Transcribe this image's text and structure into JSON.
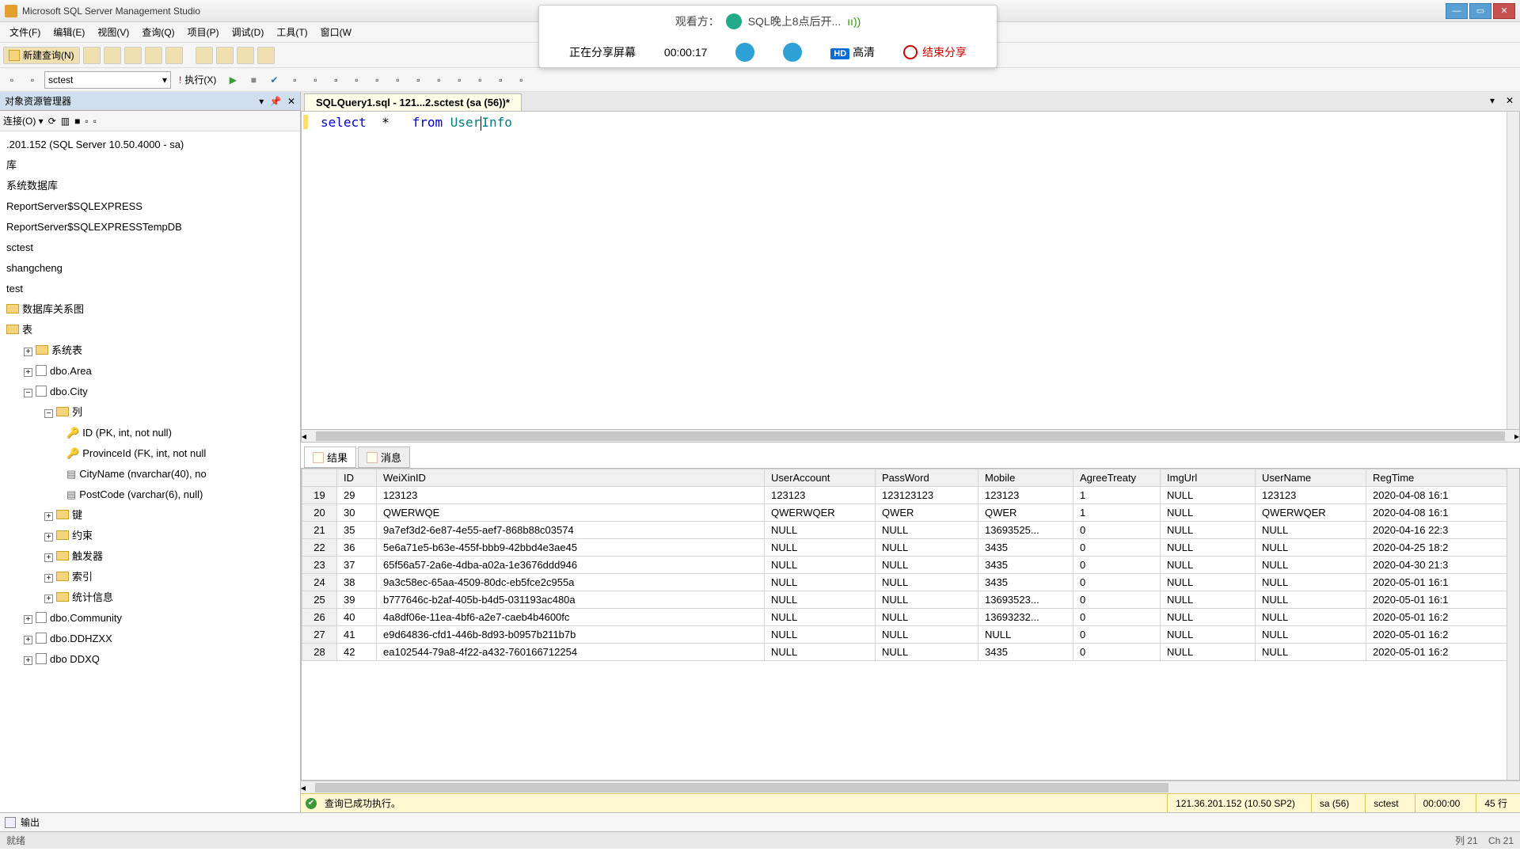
{
  "app": {
    "title": "Microsoft SQL Server Management Studio"
  },
  "menus": [
    "文件(F)",
    "编辑(E)",
    "视图(V)",
    "查询(Q)",
    "项目(P)",
    "调试(D)",
    "工具(T)",
    "窗口(W"
  ],
  "toolbar": {
    "new_query": "新建查询(N)"
  },
  "toolbar2": {
    "db_selected": "sctest",
    "execute": "执行(X)"
  },
  "share": {
    "viewer_label": "观看方：",
    "viewer_name": "SQL晚上8点后开...",
    "sharing_label": "正在分享屏幕",
    "duration": "00:00:17",
    "hd": "HD",
    "quality": "高清",
    "end": "结束分享"
  },
  "explorer": {
    "title": "对象资源管理器",
    "connect": "连接(O)",
    "server": ".201.152 (SQL Server 10.50.4000 - sa)",
    "nodes": {
      "db_root": "库",
      "sysdb": "系统数据库",
      "rptsrv": "ReportServer$SQLEXPRESS",
      "rptsrvtmp": "ReportServer$SQLEXPRESSTempDB",
      "sctest": "sctest",
      "shangcheng": "shangcheng",
      "test": "test",
      "diagram": "数据库关系图",
      "tables": "表",
      "systables": "系统表",
      "area": "dbo.Area",
      "city": "dbo.City",
      "cols": "列",
      "col_id": "ID (PK, int, not null)",
      "col_prov": "ProvinceId (FK, int, not null",
      "col_city": "CityName (nvarchar(40), no",
      "col_post": "PostCode (varchar(6), null)",
      "keys": "键",
      "constraints": "约束",
      "triggers": "触发器",
      "indexes": "索引",
      "stats": "统计信息",
      "community": "dbo.Community",
      "ddhzxx": "dbo.DDHZXX",
      "ddxq": "dbo  DDXQ"
    }
  },
  "tab": {
    "title": "SQLQuery1.sql - 121...2.sctest (sa (56))*"
  },
  "sql": {
    "select": "select",
    "star": "*",
    "from": "from",
    "user": "User",
    "info": "Info"
  },
  "results_tabs": {
    "results": "结果",
    "messages": "消息"
  },
  "grid": {
    "headers": [
      "",
      "ID",
      "WeiXinID",
      "UserAccount",
      "PassWord",
      "Mobile",
      "AgreeTreaty",
      "ImgUrl",
      "UserName",
      "RegTime"
    ],
    "rows": [
      {
        "n": "19",
        "ID": "29",
        "WeiXinID": "123123",
        "UserAccount": "123123",
        "PassWord": "123123123",
        "Mobile": "123123",
        "AgreeTreaty": "1",
        "ImgUrl": "NULL",
        "UserName": "123123",
        "RegTime": "2020-04-08 16:1"
      },
      {
        "n": "20",
        "ID": "30",
        "WeiXinID": "QWERWQE",
        "UserAccount": "QWERWQER",
        "PassWord": "QWER",
        "Mobile": "QWER",
        "AgreeTreaty": "1",
        "ImgUrl": "NULL",
        "UserName": "QWERWQER",
        "RegTime": "2020-04-08 16:1"
      },
      {
        "n": "21",
        "ID": "35",
        "WeiXinID": "9a7ef3d2-6e87-4e55-aef7-868b88c03574",
        "UserAccount": "NULL",
        "PassWord": "NULL",
        "Mobile": "13693525...",
        "AgreeTreaty": "0",
        "ImgUrl": "NULL",
        "UserName": "NULL",
        "RegTime": "2020-04-16 22:3"
      },
      {
        "n": "22",
        "ID": "36",
        "WeiXinID": "5e6a71e5-b63e-455f-bbb9-42bbd4e3ae45",
        "UserAccount": "NULL",
        "PassWord": "NULL",
        "Mobile": "3435",
        "AgreeTreaty": "0",
        "ImgUrl": "NULL",
        "UserName": "NULL",
        "RegTime": "2020-04-25 18:2"
      },
      {
        "n": "23",
        "ID": "37",
        "WeiXinID": "65f56a57-2a6e-4dba-a02a-1e3676ddd946",
        "UserAccount": "NULL",
        "PassWord": "NULL",
        "Mobile": "3435",
        "AgreeTreaty": "0",
        "ImgUrl": "NULL",
        "UserName": "NULL",
        "RegTime": "2020-04-30 21:3"
      },
      {
        "n": "24",
        "ID": "38",
        "WeiXinID": "9a3c58ec-65aa-4509-80dc-eb5fce2c955a",
        "UserAccount": "NULL",
        "PassWord": "NULL",
        "Mobile": "3435",
        "AgreeTreaty": "0",
        "ImgUrl": "NULL",
        "UserName": "NULL",
        "RegTime": "2020-05-01 16:1"
      },
      {
        "n": "25",
        "ID": "39",
        "WeiXinID": "b777646c-b2af-405b-b4d5-031193ac480a",
        "UserAccount": "NULL",
        "PassWord": "NULL",
        "Mobile": "13693523...",
        "AgreeTreaty": "0",
        "ImgUrl": "NULL",
        "UserName": "NULL",
        "RegTime": "2020-05-01 16:1"
      },
      {
        "n": "26",
        "ID": "40",
        "WeiXinID": "4a8df06e-11ea-4bf6-a2e7-caeb4b4600fc",
        "UserAccount": "NULL",
        "PassWord": "NULL",
        "Mobile": "13693232...",
        "AgreeTreaty": "0",
        "ImgUrl": "NULL",
        "UserName": "NULL",
        "RegTime": "2020-05-01 16:2"
      },
      {
        "n": "27",
        "ID": "41",
        "WeiXinID": "e9d64836-cfd1-446b-8d93-b0957b211b7b",
        "UserAccount": "NULL",
        "PassWord": "NULL",
        "Mobile": "NULL",
        "AgreeTreaty": "0",
        "ImgUrl": "NULL",
        "UserName": "NULL",
        "RegTime": "2020-05-01 16:2"
      },
      {
        "n": "28",
        "ID": "42",
        "WeiXinID": "ea102544-79a8-4f22-a432-760166712254",
        "UserAccount": "NULL",
        "PassWord": "NULL",
        "Mobile": "3435",
        "AgreeTreaty": "0",
        "ImgUrl": "NULL",
        "UserName": "NULL",
        "RegTime": "2020-05-01 16:2"
      }
    ]
  },
  "status": {
    "ok": "查询已成功执行。",
    "server": "121.36.201.152 (10.50 SP2)",
    "user": "sa (56)",
    "db": "sctest",
    "time": "00:00:00",
    "rows": "45 行"
  },
  "output_label": "输出",
  "app_status": {
    "left": "就绪",
    "col": "列 21",
    "ch": "Ch 21"
  }
}
